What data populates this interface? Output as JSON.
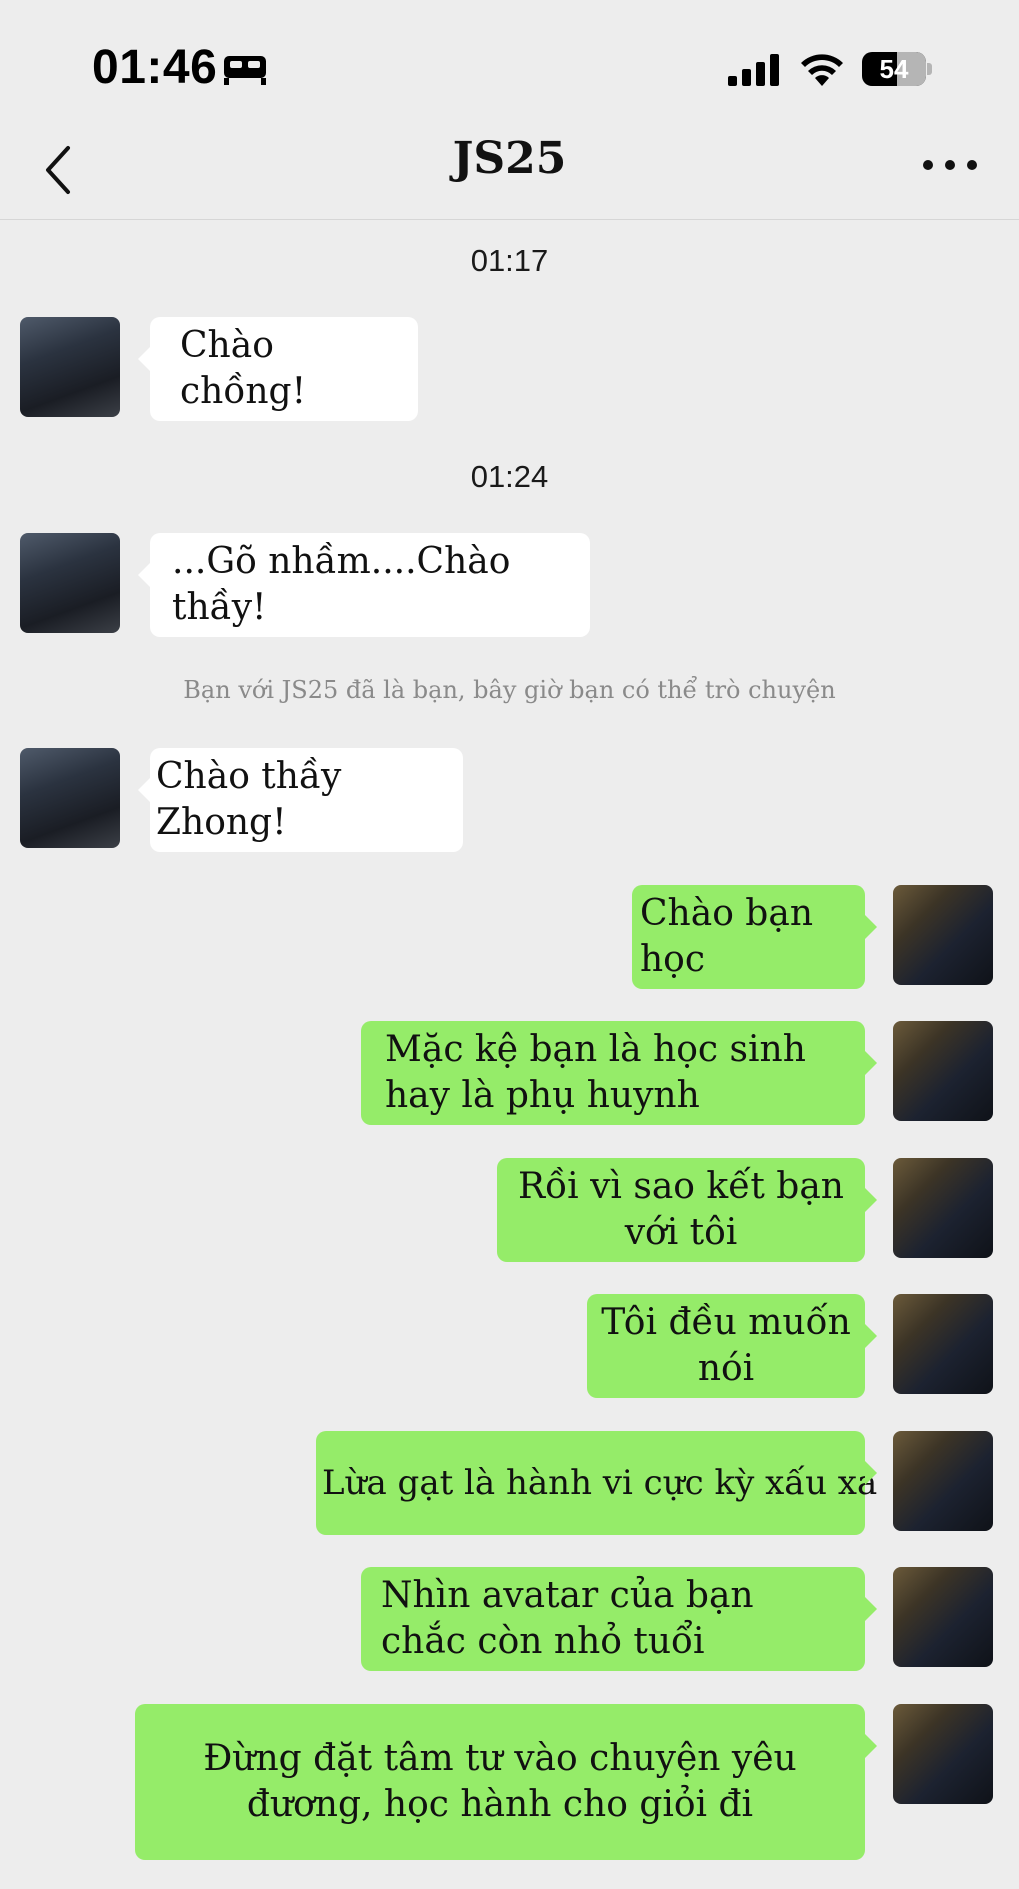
{
  "status_bar": {
    "time": "01:46",
    "battery": "54",
    "battery_level_percent": 54,
    "icons": [
      "sleep-bed-icon",
      "cellular-signal-icon",
      "wifi-icon",
      "battery-icon"
    ]
  },
  "nav": {
    "title": "JS25",
    "back_icon": "chevron-left-icon",
    "more_icon": "more-dots-icon"
  },
  "chat": {
    "timestamps": [
      "01:17",
      "01:24"
    ],
    "system_note": "Bạn với JS25 đã là bạn, bây giờ bạn có thể trò chuyện",
    "incoming": [
      "Chào chồng!",
      "...Gõ nhầm....Chào thầy!",
      "Chào thầy Zhong!"
    ],
    "outgoing": [
      "Chào bạn học",
      "Mặc kệ bạn là học sinh hay là phụ huynh",
      "Rồi vì sao kết bạn với tôi",
      "Tôi đều muốn nói",
      "Lừa gạt là hành vi cực kỳ xấu xa",
      "Nhìn avatar của bạn chắc còn nhỏ tuổi",
      "Đừng đặt tâm tư vào chuyện yêu đương, học hành cho giỏi đi"
    ]
  },
  "colors": {
    "background": "#ededed",
    "incoming_bubble": "#ffffff",
    "outgoing_bubble": "#95ec69",
    "system_text": "#8a8a8a"
  }
}
